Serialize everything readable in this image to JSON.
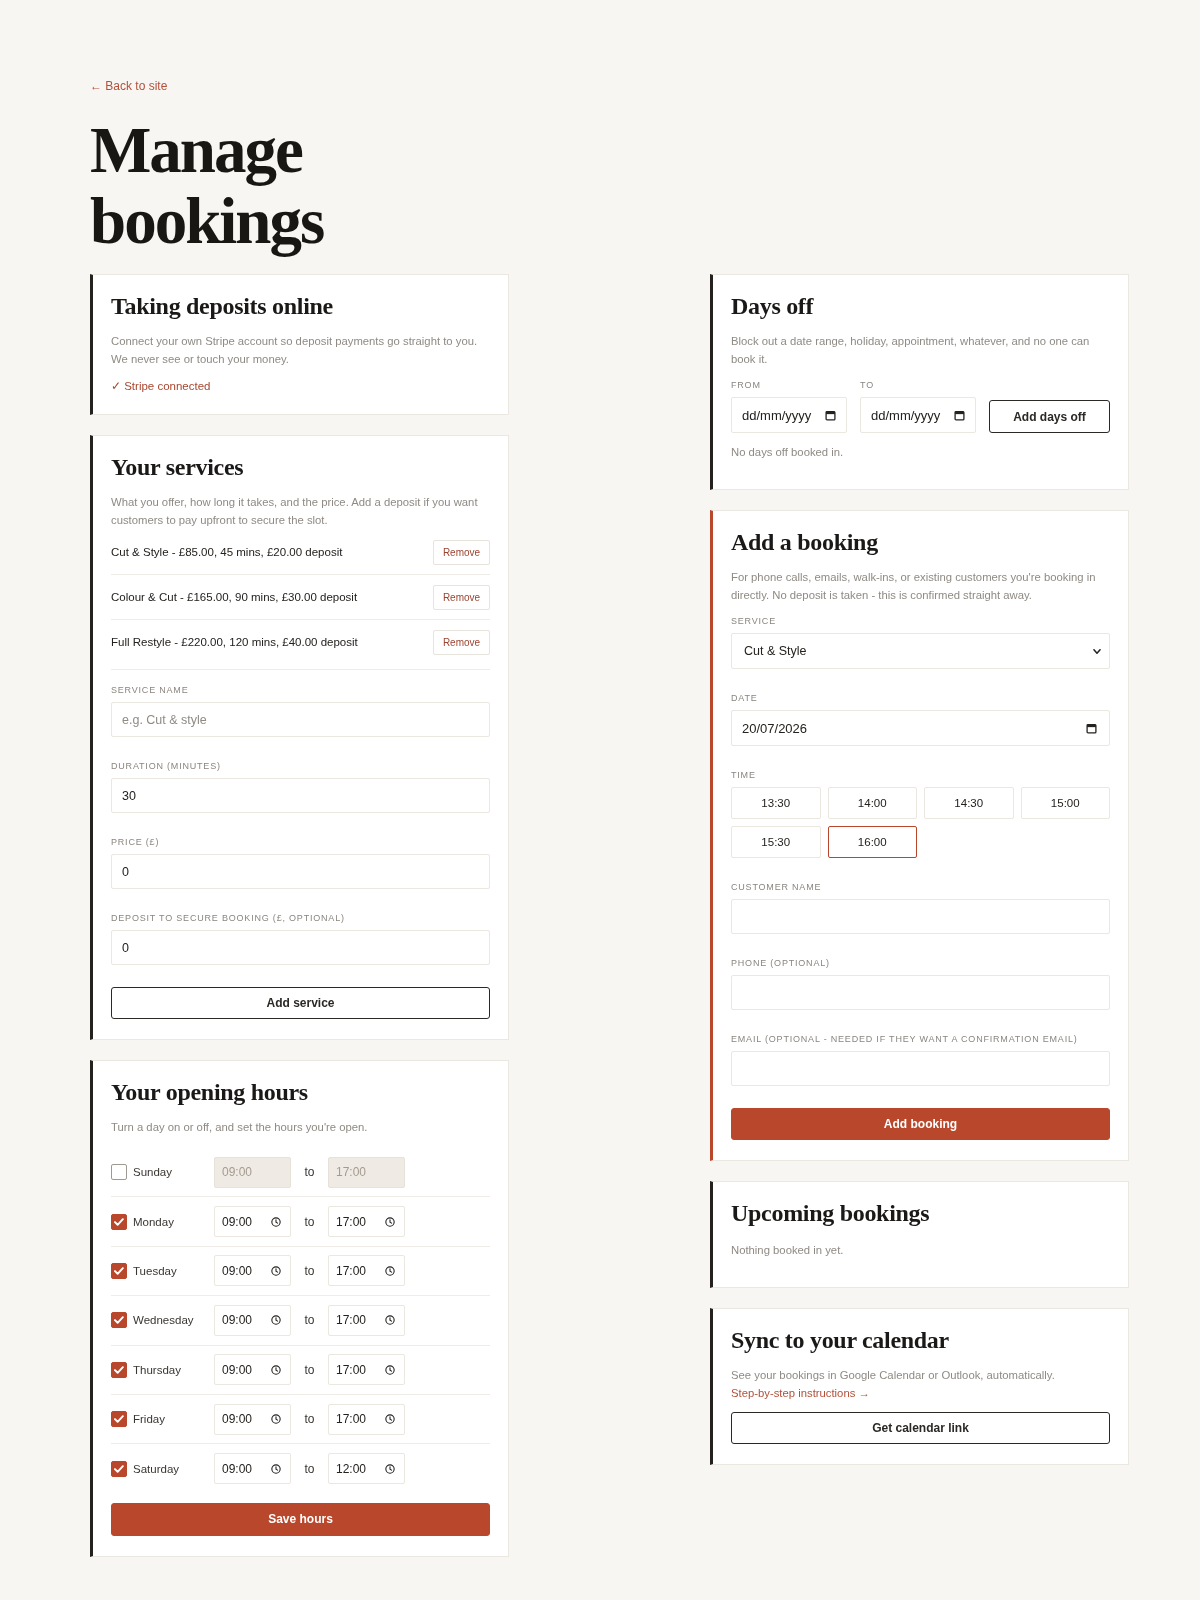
{
  "back_link": "← Back to site",
  "title": "Manage bookings",
  "left_column": [
    {
      "kind": "deposits",
      "highlighted": false,
      "title": "Taking deposits online",
      "description": "Connect your own Stripe account so deposit payments go straight to you. We never see or touch your money.",
      "status": "✓ Stripe connected"
    },
    {
      "kind": "services",
      "highlighted": false,
      "title": "Your services",
      "description": "What you offer, how long it takes, and the price. Add a deposit if you want customers to pay upfront to secure the slot.",
      "services": [
        {
          "text": "Cut & Style - £85.00, 45 mins, £20.00 deposit",
          "action": "Remove"
        },
        {
          "text": "Colour & Cut - £165.00, 90 mins, £30.00 deposit",
          "action": "Remove"
        },
        {
          "text": "Full Restyle - £220.00, 120 mins, £40.00 deposit",
          "action": "Remove"
        }
      ],
      "fields": [
        {
          "label": "SERVICE NAME",
          "placeholder": "e.g. Cut & style"
        },
        {
          "label": "DURATION (MINUTES)",
          "value": "30"
        },
        {
          "label": "PRICE (£)",
          "value": "0"
        },
        {
          "label": "DEPOSIT TO SECURE BOOKING (£, OPTIONAL)",
          "value": "0"
        }
      ],
      "button": {
        "label": "Add service",
        "primary": false
      }
    },
    {
      "kind": "hours",
      "highlighted": false,
      "title": "Your opening hours",
      "description": "Turn a day on or off, and set the hours you're open.",
      "days": [
        {
          "day": "Sunday",
          "checked": false,
          "open": "09:00",
          "separator": "to",
          "close": "17:00"
        },
        {
          "day": "Monday",
          "checked": true,
          "open": "09:00",
          "separator": "to",
          "close": "17:00"
        },
        {
          "day": "Tuesday",
          "checked": true,
          "open": "09:00",
          "separator": "to",
          "close": "17:00"
        },
        {
          "day": "Wednesday",
          "checked": true,
          "open": "09:00",
          "separator": "to",
          "close": "17:00"
        },
        {
          "day": "Thursday",
          "checked": true,
          "open": "09:00",
          "separator": "to",
          "close": "17:00"
        },
        {
          "day": "Friday",
          "checked": true,
          "open": "09:00",
          "separator": "to",
          "close": "17:00"
        },
        {
          "day": "Saturday",
          "checked": true,
          "open": "09:00",
          "separator": "to",
          "close": "12:00"
        }
      ],
      "button": {
        "label": "Save hours",
        "primary": true
      }
    }
  ],
  "right_column": [
    {
      "kind": "days_off",
      "highlighted": false,
      "title": "Days off",
      "description": "Block out a date range, holiday, appointment, whatever, and no one can book it.",
      "fields": [
        {
          "label": "FROM",
          "placeholder": "dd/mm/yyyy"
        },
        {
          "label": "TO",
          "placeholder": "dd/mm/yyyy"
        }
      ],
      "button": {
        "label": "Add days off",
        "primary": false
      },
      "note": "No days off booked in."
    },
    {
      "kind": "add_booking",
      "highlighted": true,
      "title": "Add a booking",
      "description": "For phone calls, emails, walk-ins, or existing customers you're booking in directly. No deposit is taken - this is confirmed straight away.",
      "service": {
        "label": "SERVICE",
        "value": "Cut & Style"
      },
      "date": {
        "label": "DATE",
        "value": "20/07/2026"
      },
      "time": {
        "label": "TIME",
        "slots": [
          {
            "label": "13:30",
            "selected": false
          },
          {
            "label": "14:00",
            "selected": false
          },
          {
            "label": "14:30",
            "selected": false
          },
          {
            "label": "15:00",
            "selected": false
          },
          {
            "label": "15:30",
            "selected": false
          },
          {
            "label": "16:00",
            "selected": true
          }
        ]
      },
      "fields": [
        {
          "label": "CUSTOMER NAME"
        },
        {
          "label": "PHONE (OPTIONAL)"
        },
        {
          "label": "EMAIL (OPTIONAL - NEEDED IF THEY WANT A CONFIRMATION EMAIL)"
        }
      ],
      "button": {
        "label": "Add booking",
        "primary": true
      }
    },
    {
      "kind": "upcoming",
      "highlighted": false,
      "title": "Upcoming bookings",
      "note": "Nothing booked in yet."
    },
    {
      "kind": "sync",
      "highlighted": false,
      "title": "Sync to your calendar",
      "description": "See your bookings in Google Calendar or Outlook, automatically.",
      "link": "Step-by-step instructions →",
      "button": {
        "label": "Get calendar link",
        "primary": false
      }
    }
  ]
}
